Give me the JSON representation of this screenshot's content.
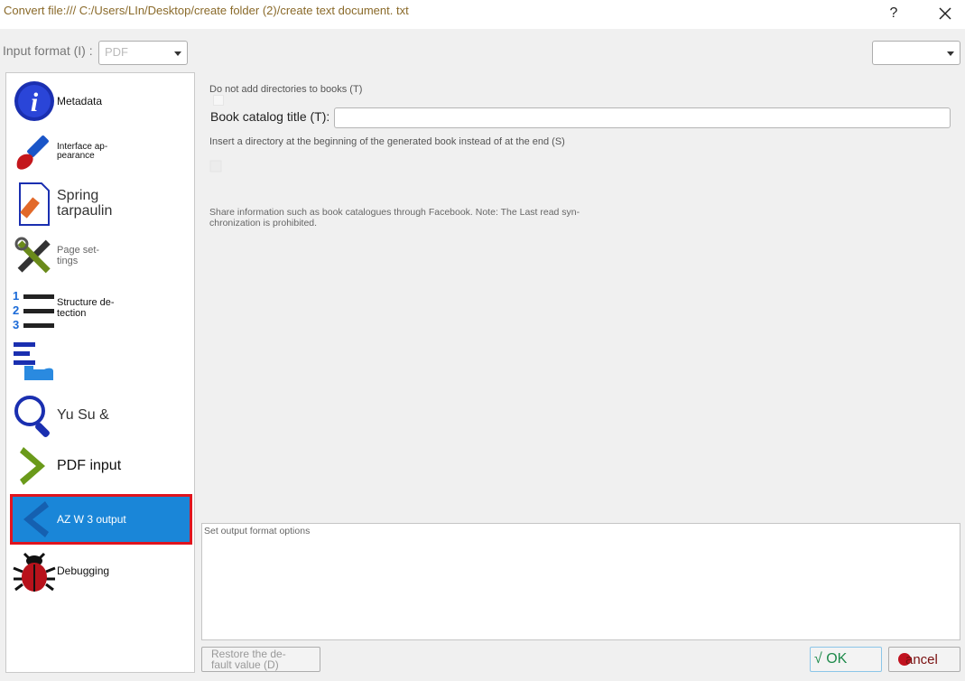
{
  "window": {
    "title": "Convert file:/// C:/Users/LIn/Desktop/create folder (2)/create text document. txt",
    "help_label": "?",
    "close_label": "✕"
  },
  "toolbar": {
    "input_format_label": "Input format (I) :",
    "input_format_value": "PDF",
    "output_format_label": "",
    "output_format_value": ""
  },
  "sidebar": {
    "items": [
      {
        "label": "Metadata",
        "icon": "info-icon"
      },
      {
        "label": "Interface ap-\npearance",
        "icon": "brush-icon"
      },
      {
        "label": "Spring\ntarpaulin",
        "icon": "book-cover-icon"
      },
      {
        "label": "Page set-\ntings",
        "icon": "tools-icon"
      },
      {
        "label": "Structure de-\ntection",
        "icon": "structure-icon"
      },
      {
        "label": "",
        "icon": "toc-icon"
      },
      {
        "label": "Yu Su &",
        "icon": "search-icon"
      },
      {
        "label": "PDF input",
        "icon": "chevron-right-icon"
      },
      {
        "label": "AZ W 3 output",
        "icon": "chevron-left-icon",
        "selected": true
      },
      {
        "label": "Debugging",
        "icon": "bug-icon"
      }
    ]
  },
  "options": {
    "no_directories_label": "Do not add directories to books (T)",
    "catalog_title_label": "Book catalog title (T):",
    "catalog_title_value": "",
    "insert_toc_label": "Insert a directory at the beginning of the generated book instead of at the end (S)",
    "facebook_note": "Share information such as book catalogues through Facebook. Note: The Last read syn-\nchronization is prohibited."
  },
  "help_panel": {
    "title": "Set output format options"
  },
  "buttons": {
    "restore_label": "Restore the de-\nfault value (D)",
    "ok_label": "√ OK",
    "cancel_label": "ancel"
  },
  "colors": {
    "selection": "#1a86d8",
    "highlight_border": "#e0141e",
    "title_text": "#8a6a2a"
  }
}
